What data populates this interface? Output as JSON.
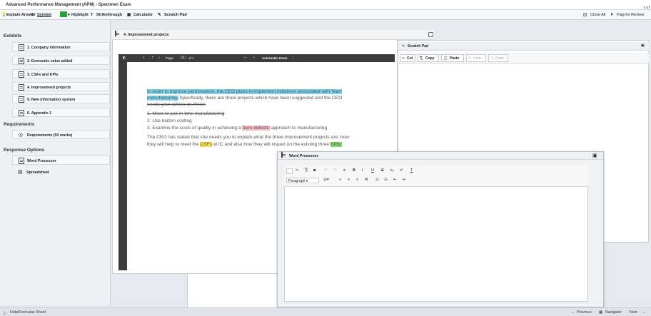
{
  "window": {
    "title": "Advanced Performance Management (APM) - Specimen Exam",
    "question_count": "1 of"
  },
  "toolbar": {
    "explain": "Explain Answer",
    "symbol": "Symbol",
    "highlight": "Highlight",
    "strikethrough": "Strikethrough",
    "calculator": "Calculator",
    "scratch_pad": "Scratch Pad",
    "close_all": "Close All",
    "flag": "Flag for Review"
  },
  "sidebar": {
    "exhibits_title": "Exhibits",
    "exhibits": [
      "1. Company information",
      "2. Economic value added",
      "3. CSFs and KPIs",
      "4. Improvement projects",
      "5. New information system",
      "6. Appendix 1"
    ],
    "requirements_title": "Requirements",
    "requirements": [
      "Requirements (50 marks)"
    ],
    "response_title": "Response Options",
    "responses": [
      "Word Processor",
      "Spreadsheet"
    ]
  },
  "document": {
    "tab_title": "4. Improvement projects",
    "pdf_page_label": "Page:",
    "pdf_page_value": "1",
    "pdf_page_total": "of 1",
    "pdf_zoom": "Automatic Zoom",
    "para1_line1": "In order to improve performance, the CEO plans to implement initiatives associated with 'lean'",
    "para1_line2a": "manufacturing.",
    "para1_line2b": " Specifically, there are three projects which have been suggested and the CEO",
    "para1_line3": "needs your advice on these:",
    "list": [
      "1.   Move to just-in-time manufacturing",
      "2.   Use kaizen costing",
      "3.   Examine the costs of quality in achieving a "
    ],
    "zero_defects": "'zero defects'",
    "list3_tail": " approach to manufacturing",
    "para2_line1": "The CEO has stated that she needs you to explain what the three improvement projects are, how",
    "para2_line2a": "they will help to meet the ",
    "csfs": "CSFs",
    "para2_line2b": " at IC and also how they will impact on the existing three ",
    "kpis": "KPIs."
  },
  "scratch": {
    "title": "Scratch Pad",
    "cut": "Cut",
    "copy": "Copy",
    "paste": "Paste",
    "undo": "Undo",
    "redo": "Redo"
  },
  "word_processor": {
    "title": "Word Processor",
    "paragraph_select": "Paragraph"
  },
  "footer": {
    "help": "Help/Formulae Sheet",
    "previous": "Previous",
    "navigator": "Navigator",
    "next": "Next"
  },
  "colors": {
    "highlight_swatch": "#2ea042",
    "hl_blue": "#7fd2ee",
    "hl_pink": "#f6b9c6",
    "hl_yellow": "#f6e04d",
    "hl_green": "#7edc6a"
  }
}
